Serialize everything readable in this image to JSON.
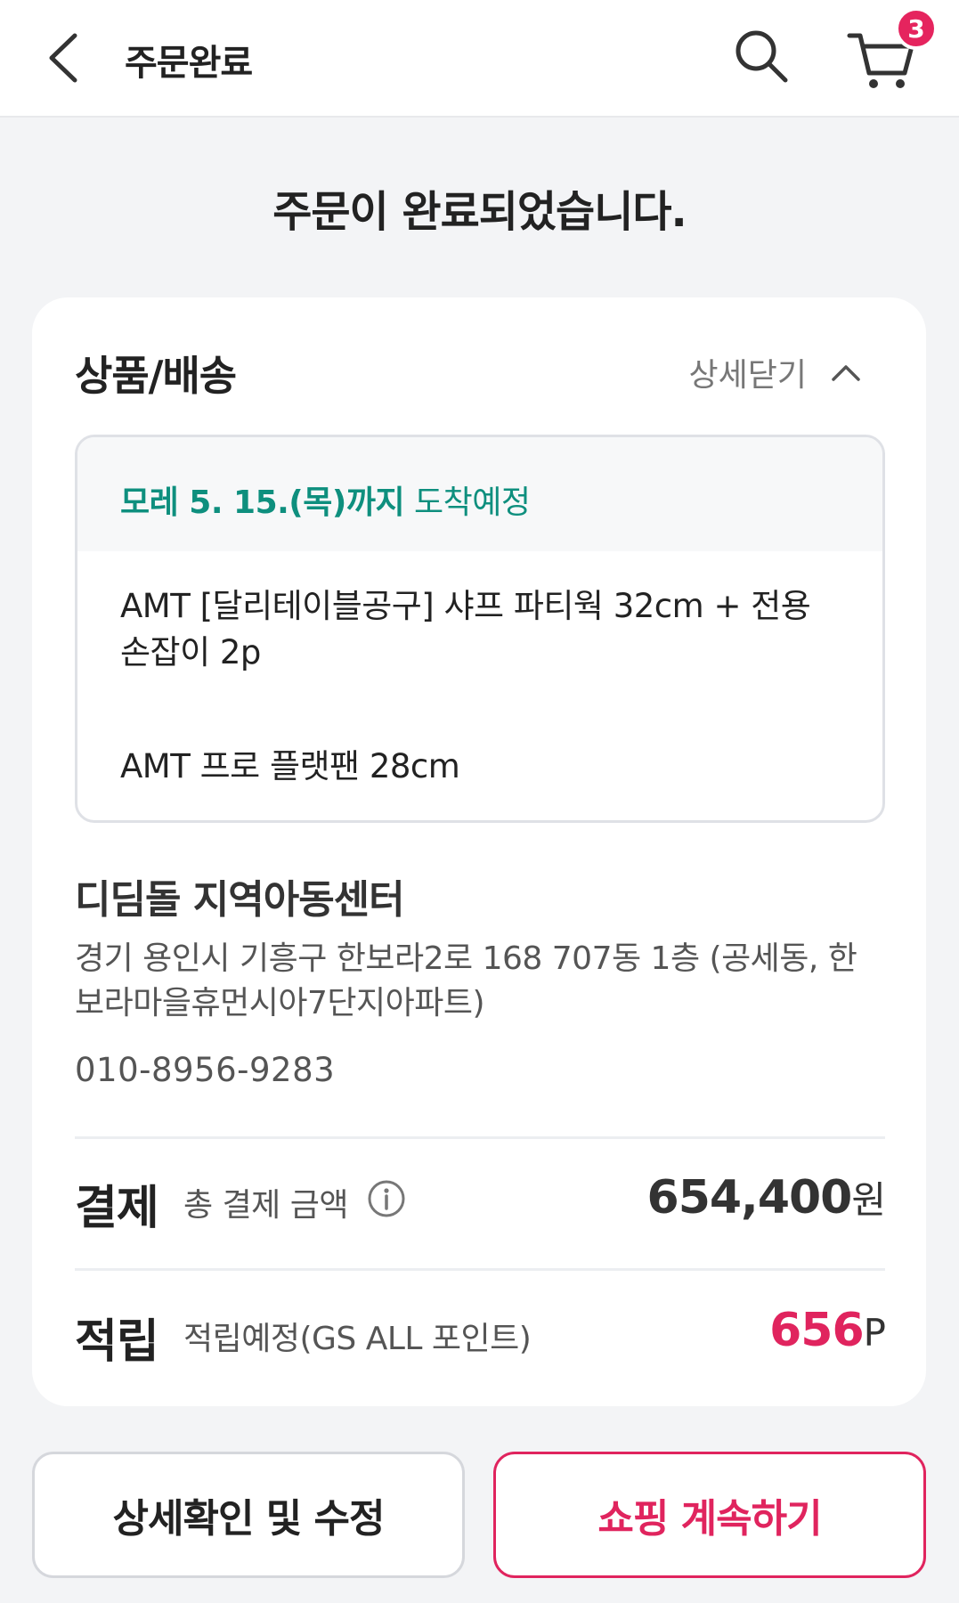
{
  "header": {
    "title": "주문완료",
    "back_icon": "chevron-left-icon",
    "search_icon": "search-icon",
    "cart_icon": "cart-icon",
    "cart_badge": "3"
  },
  "message": "주문이 완료되었습니다.",
  "shipping": {
    "section_title": "상품/배송",
    "toggle_label": "상세닫기",
    "arrival_date": "모레 5. 15.(목)까지",
    "arrival_suffix": " 도착예정",
    "items": [
      "AMT [달리테이블공구] 샤프 파티웍 32cm + 전용 손잡이 2p",
      "AMT 프로 플랫팬 28cm"
    ]
  },
  "recipient": {
    "name": "디딤돌 지역아동센터",
    "address": "경기 용인시 기흥구 한보라2로 168 707동 1층 (공세동, 한보라마을휴먼시아7단지아파트)",
    "phone": "010-8956-9283"
  },
  "payment": {
    "label": "결제",
    "sub_label": "총 결제 금액",
    "amount": "654,400",
    "unit": "원"
  },
  "points": {
    "label": "적립",
    "sub_label": "적립예정(GS ALL 포인트)",
    "amount": "656",
    "unit": "P"
  },
  "buttons": {
    "detail": "상세확인 및 수정",
    "continue": "쇼핑 계속하기"
  },
  "colors": {
    "accent": "#e0245e",
    "arrival": "#0e8f7e",
    "background": "#f3f4f6"
  }
}
